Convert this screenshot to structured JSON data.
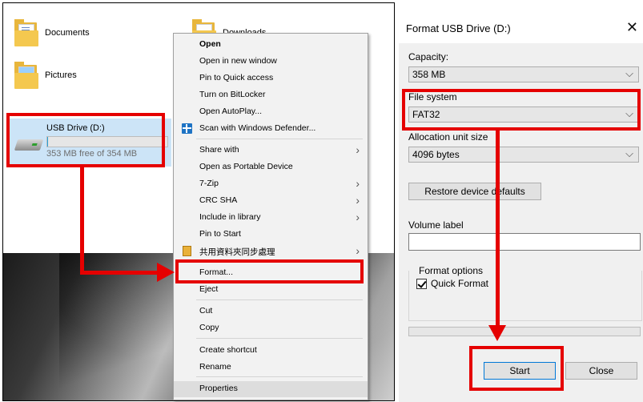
{
  "explorer": {
    "items": [
      {
        "label": "Documents",
        "icon": "documents-folder-icon"
      },
      {
        "label": "Downloads",
        "icon": "downloads-folder-icon"
      },
      {
        "label": "Pictures",
        "icon": "pictures-folder-icon"
      }
    ],
    "usb": {
      "name": "USB Drive (D:)",
      "free_text": "353 MB free of 354 MB",
      "used_fraction": 0.003
    }
  },
  "context_menu": {
    "items": [
      {
        "label": "Open",
        "bold": true
      },
      {
        "label": "Open in new window"
      },
      {
        "label": "Pin to Quick access"
      },
      {
        "label": "Turn on BitLocker"
      },
      {
        "label": "Open AutoPlay..."
      },
      {
        "label": "Scan with Windows Defender...",
        "icon": "windows-defender-icon"
      },
      {
        "label": "Share with",
        "submenu": true
      },
      {
        "label": "Open as Portable Device"
      },
      {
        "label": "7-Zip",
        "submenu": true
      },
      {
        "label": "CRC SHA",
        "submenu": true
      },
      {
        "label": "Include in library",
        "submenu": true
      },
      {
        "label": "Pin to Start"
      },
      {
        "label": "共用資料夾同步處理",
        "submenu": true,
        "icon": "sync-folder-icon"
      },
      {
        "label": "Format..."
      },
      {
        "label": "Eject"
      },
      {
        "label": "Cut"
      },
      {
        "label": "Copy"
      },
      {
        "label": "Create shortcut"
      },
      {
        "label": "Rename"
      },
      {
        "label": "Properties"
      }
    ],
    "submenu_glyph": "›"
  },
  "dialog": {
    "title": "Format USB Drive (D:)",
    "close_glyph": "✕",
    "capacity_label": "Capacity:",
    "capacity_value": "358 MB",
    "filesystem_label": "File system",
    "filesystem_value": "FAT32",
    "allocation_label": "Allocation unit size",
    "allocation_value": "4096 bytes",
    "restore_button": "Restore device defaults",
    "volume_label": "Volume label",
    "volume_value": "",
    "format_options_label": "Format options",
    "quick_format_label": "Quick Format",
    "quick_format_checked": true,
    "start_button": "Start",
    "close_button": "Close",
    "dropdown_glyph": "⌵"
  },
  "colors": {
    "annotation": "#e50000",
    "selection": "#cce4f7",
    "menu_bg": "#f2f2f2",
    "dialog_bg": "#f0f0f0"
  }
}
